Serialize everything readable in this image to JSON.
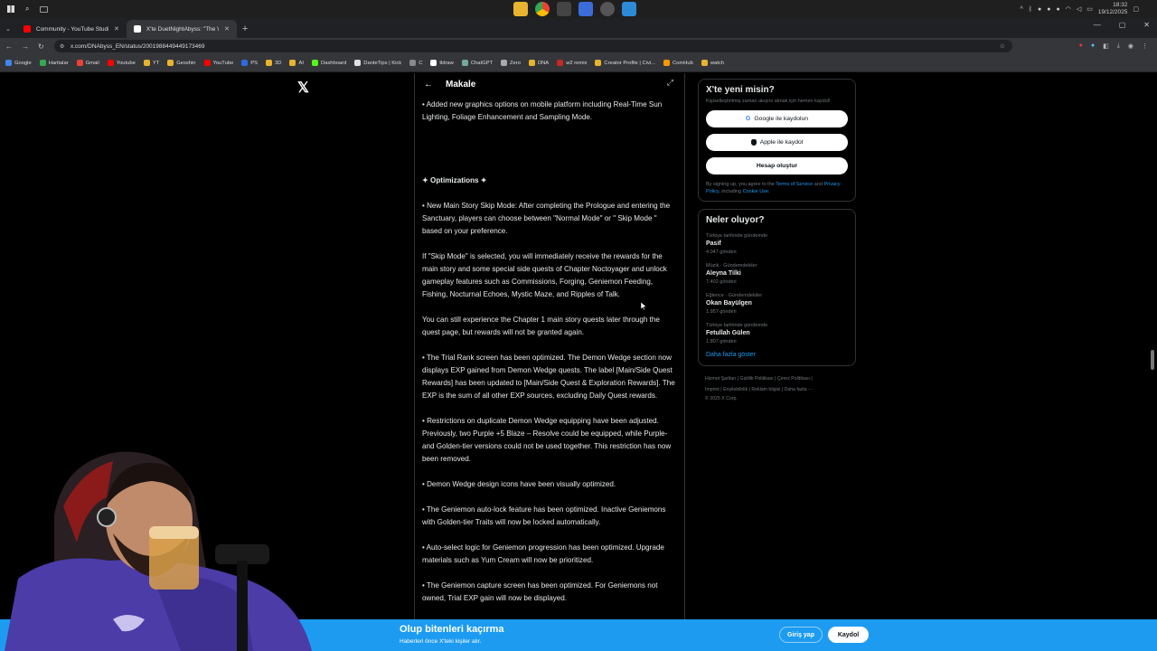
{
  "taskbar": {
    "time": "18:32",
    "date": "19/12/2025"
  },
  "browser": {
    "tabs": [
      {
        "title": "Community - YouTube Studio",
        "color": "#ff0000"
      },
      {
        "title": "X'te DuetNightAbyss: \"The Wi...",
        "color": "#ffffff"
      }
    ],
    "url": "x.com/DNAbyss_EN/status/2001988449449173469",
    "bookmarks": [
      "Google",
      "Haritalar",
      "Gmail",
      "Youtube",
      "YT",
      "Gesshin",
      "YouTube",
      "PS",
      "3D",
      "AI",
      "Dashboard",
      "DanteTips | Kick",
      "C",
      "tldraw",
      "ChatGPT",
      "Zero",
      "DNA",
      "w2 remix",
      "Creator Profile | Civi...",
      "ComHub",
      "watch"
    ]
  },
  "article": {
    "header_title": "Makale",
    "paragraphs": [
      {
        "text": "• Added new graphics options on mobile platform including Real-Time Sun Lighting, Foliage Enhancement and Sampling Mode.",
        "bold": false
      },
      {
        "text": " ",
        "bold": false
      },
      {
        "text": "✦ Optimizations ✦",
        "bold": true
      },
      {
        "text": "• New Main Story Skip Mode: After completing the Prologue and entering the Sanctuary, players can choose between \"Normal Mode\" or \" Skip Mode \" based on your preference.",
        "bold": false
      },
      {
        "text": "If \"Skip Mode\" is selected, you will immediately receive the rewards for the main story and some special side quests of Chapter Noctoyager and unlock gameplay features such as Commissions, Forging, Geniemon Feeding, Fishing, Nocturnal Echoes, Mystic Maze, and Ripples of Talk.",
        "bold": false
      },
      {
        "text": "You can still experience the Chapter 1 main story quests later through the quest page, but rewards will not be granted again.",
        "bold": false
      },
      {
        "text": "• The Trial Rank screen has been optimized. The Demon Wedge section now displays EXP gained from Demon Wedge quests. The label [Main/Side Quest Rewards] has been updated to [Main/Side Quest & Exploration Rewards]. The EXP is the sum of all other EXP sources, excluding Daily Quest rewards.",
        "bold": false
      },
      {
        "text": "• Restrictions on duplicate Demon Wedge equipping have been adjusted. Previously, two Purple +5 Blaze – Resolve could be equipped, while Purple- and Golden-tier versions could not be used together. This restriction has now been removed.",
        "bold": false
      },
      {
        "text": "• Demon Wedge design icons have been visually optimized.",
        "bold": false
      },
      {
        "text": "• The Geniemon auto-lock feature has been optimized. Inactive Geniemons with Golden-tier Traits will now be locked automatically.",
        "bold": false
      },
      {
        "text": "• Auto-select logic for Geniemon progression has been optimized. Upgrade materials such as Yum Cream will now be prioritized.",
        "bold": false
      },
      {
        "text": "• The Geniemon capture screen has been optimized. For Geniemons not owned, Trial EXP gain will now be displayed.",
        "bold": false
      }
    ]
  },
  "signup_card": {
    "title": "X'te yeni misin?",
    "subtitle": "Kişiselleştirilmiş zaman akışını almak için hemen kaydol!",
    "google_button": "Google ile kaydolun",
    "apple_button": "Apple ile kaydol",
    "create_button": "Hesap oluştur",
    "terms_prefix": "By signing up, you agree to the ",
    "terms_link": "Terms of Service",
    "terms_and": " and ",
    "privacy_link": "Privacy Policy",
    "terms_including": ", including ",
    "cookie_link": "Cookie Use."
  },
  "trends": {
    "title": "Neler oluyor?",
    "items": [
      {
        "context": "Türkiye tarihinde gündemde",
        "name": "Pasif",
        "count": "4.047 gönderi"
      },
      {
        "context": "Müzik · Gündemdekiler",
        "name": "Aleyna Tilki",
        "count": "7.402 gönderi"
      },
      {
        "context": "Eğlence · Gündemdekiler",
        "name": "Okan Bayülgen",
        "count": "1.957 gönderi"
      },
      {
        "context": "Türkiye tarihinde gündemde",
        "name": "Fetullah Gülen",
        "count": "1.807 gönderi"
      }
    ],
    "show_more": "Daha fazla göster"
  },
  "footer": {
    "line1": "Hizmet Şartları  |  Gizlilik Politikası  |  Çerez Politikası  |",
    "line2": "Imprint  |  Erişilebilirlik  |  Reklam bilgisi  |  Daha fazla ···",
    "line3": "© 2025 X Corp."
  },
  "banner": {
    "title": "Olup bitenleri kaçırma",
    "subtitle": "Haberleri önce X'teki kişiler alır.",
    "login": "Giriş yap",
    "signup": "Kaydol"
  },
  "colors": {
    "accent": "#1d9bf0",
    "background": "#000000",
    "border": "#2f3336"
  }
}
